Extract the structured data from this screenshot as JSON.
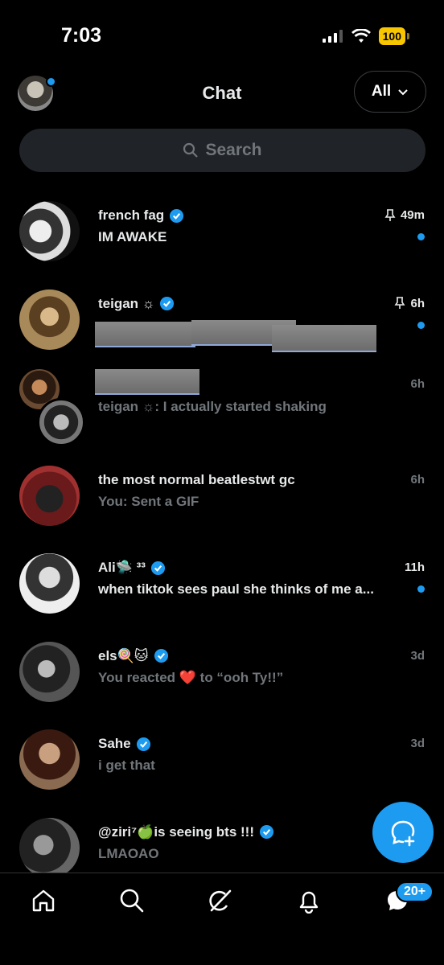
{
  "status": {
    "time": "7:03",
    "battery": "100"
  },
  "header": {
    "title": "Chat",
    "filter_label": "All"
  },
  "search": {
    "placeholder": "Search"
  },
  "chats": [
    {
      "name": "french fag",
      "verified": true,
      "pinned": true,
      "time": "49m",
      "preview": "IM AWAKE",
      "unread": true
    },
    {
      "name": "teigan ☼",
      "verified": true,
      "pinned": true,
      "time": "6h",
      "preview": "",
      "unread": true,
      "redacted": true
    },
    {
      "name": "",
      "verified": false,
      "pinned": false,
      "time": "6h",
      "preview": "teigan ☼: I actually started shaking",
      "unread": false,
      "redacted_name": true
    },
    {
      "name": "the most normal beatlestwt gc",
      "verified": false,
      "pinned": false,
      "time": "6h",
      "preview": "You: Sent a GIF",
      "unread": false
    },
    {
      "name": "Ali🛸 ³³",
      "verified": true,
      "pinned": false,
      "time": "11h",
      "preview": "when tiktok sees paul she thinks of me a...",
      "unread": true
    },
    {
      "name": "els🍭🐱",
      "verified": true,
      "pinned": false,
      "time": "3d",
      "preview": "You reacted ❤️ to “ooh Ty!!”",
      "unread": false
    },
    {
      "name": "Sahe",
      "verified": true,
      "pinned": false,
      "time": "3d",
      "preview": "i get that",
      "unread": false
    },
    {
      "name": "@ziri⁷🍏is seeing bts !!!",
      "verified": true,
      "pinned": false,
      "time": "",
      "preview": "LMAOAO",
      "unread": false
    }
  ],
  "tabs": [
    "home-icon",
    "search-icon",
    "grok-icon",
    "notifications-icon",
    "messages-icon"
  ],
  "messages_badge": "20+",
  "colors": {
    "accent": "#1d9bf0",
    "background": "#000000",
    "muted": "#71767b"
  }
}
